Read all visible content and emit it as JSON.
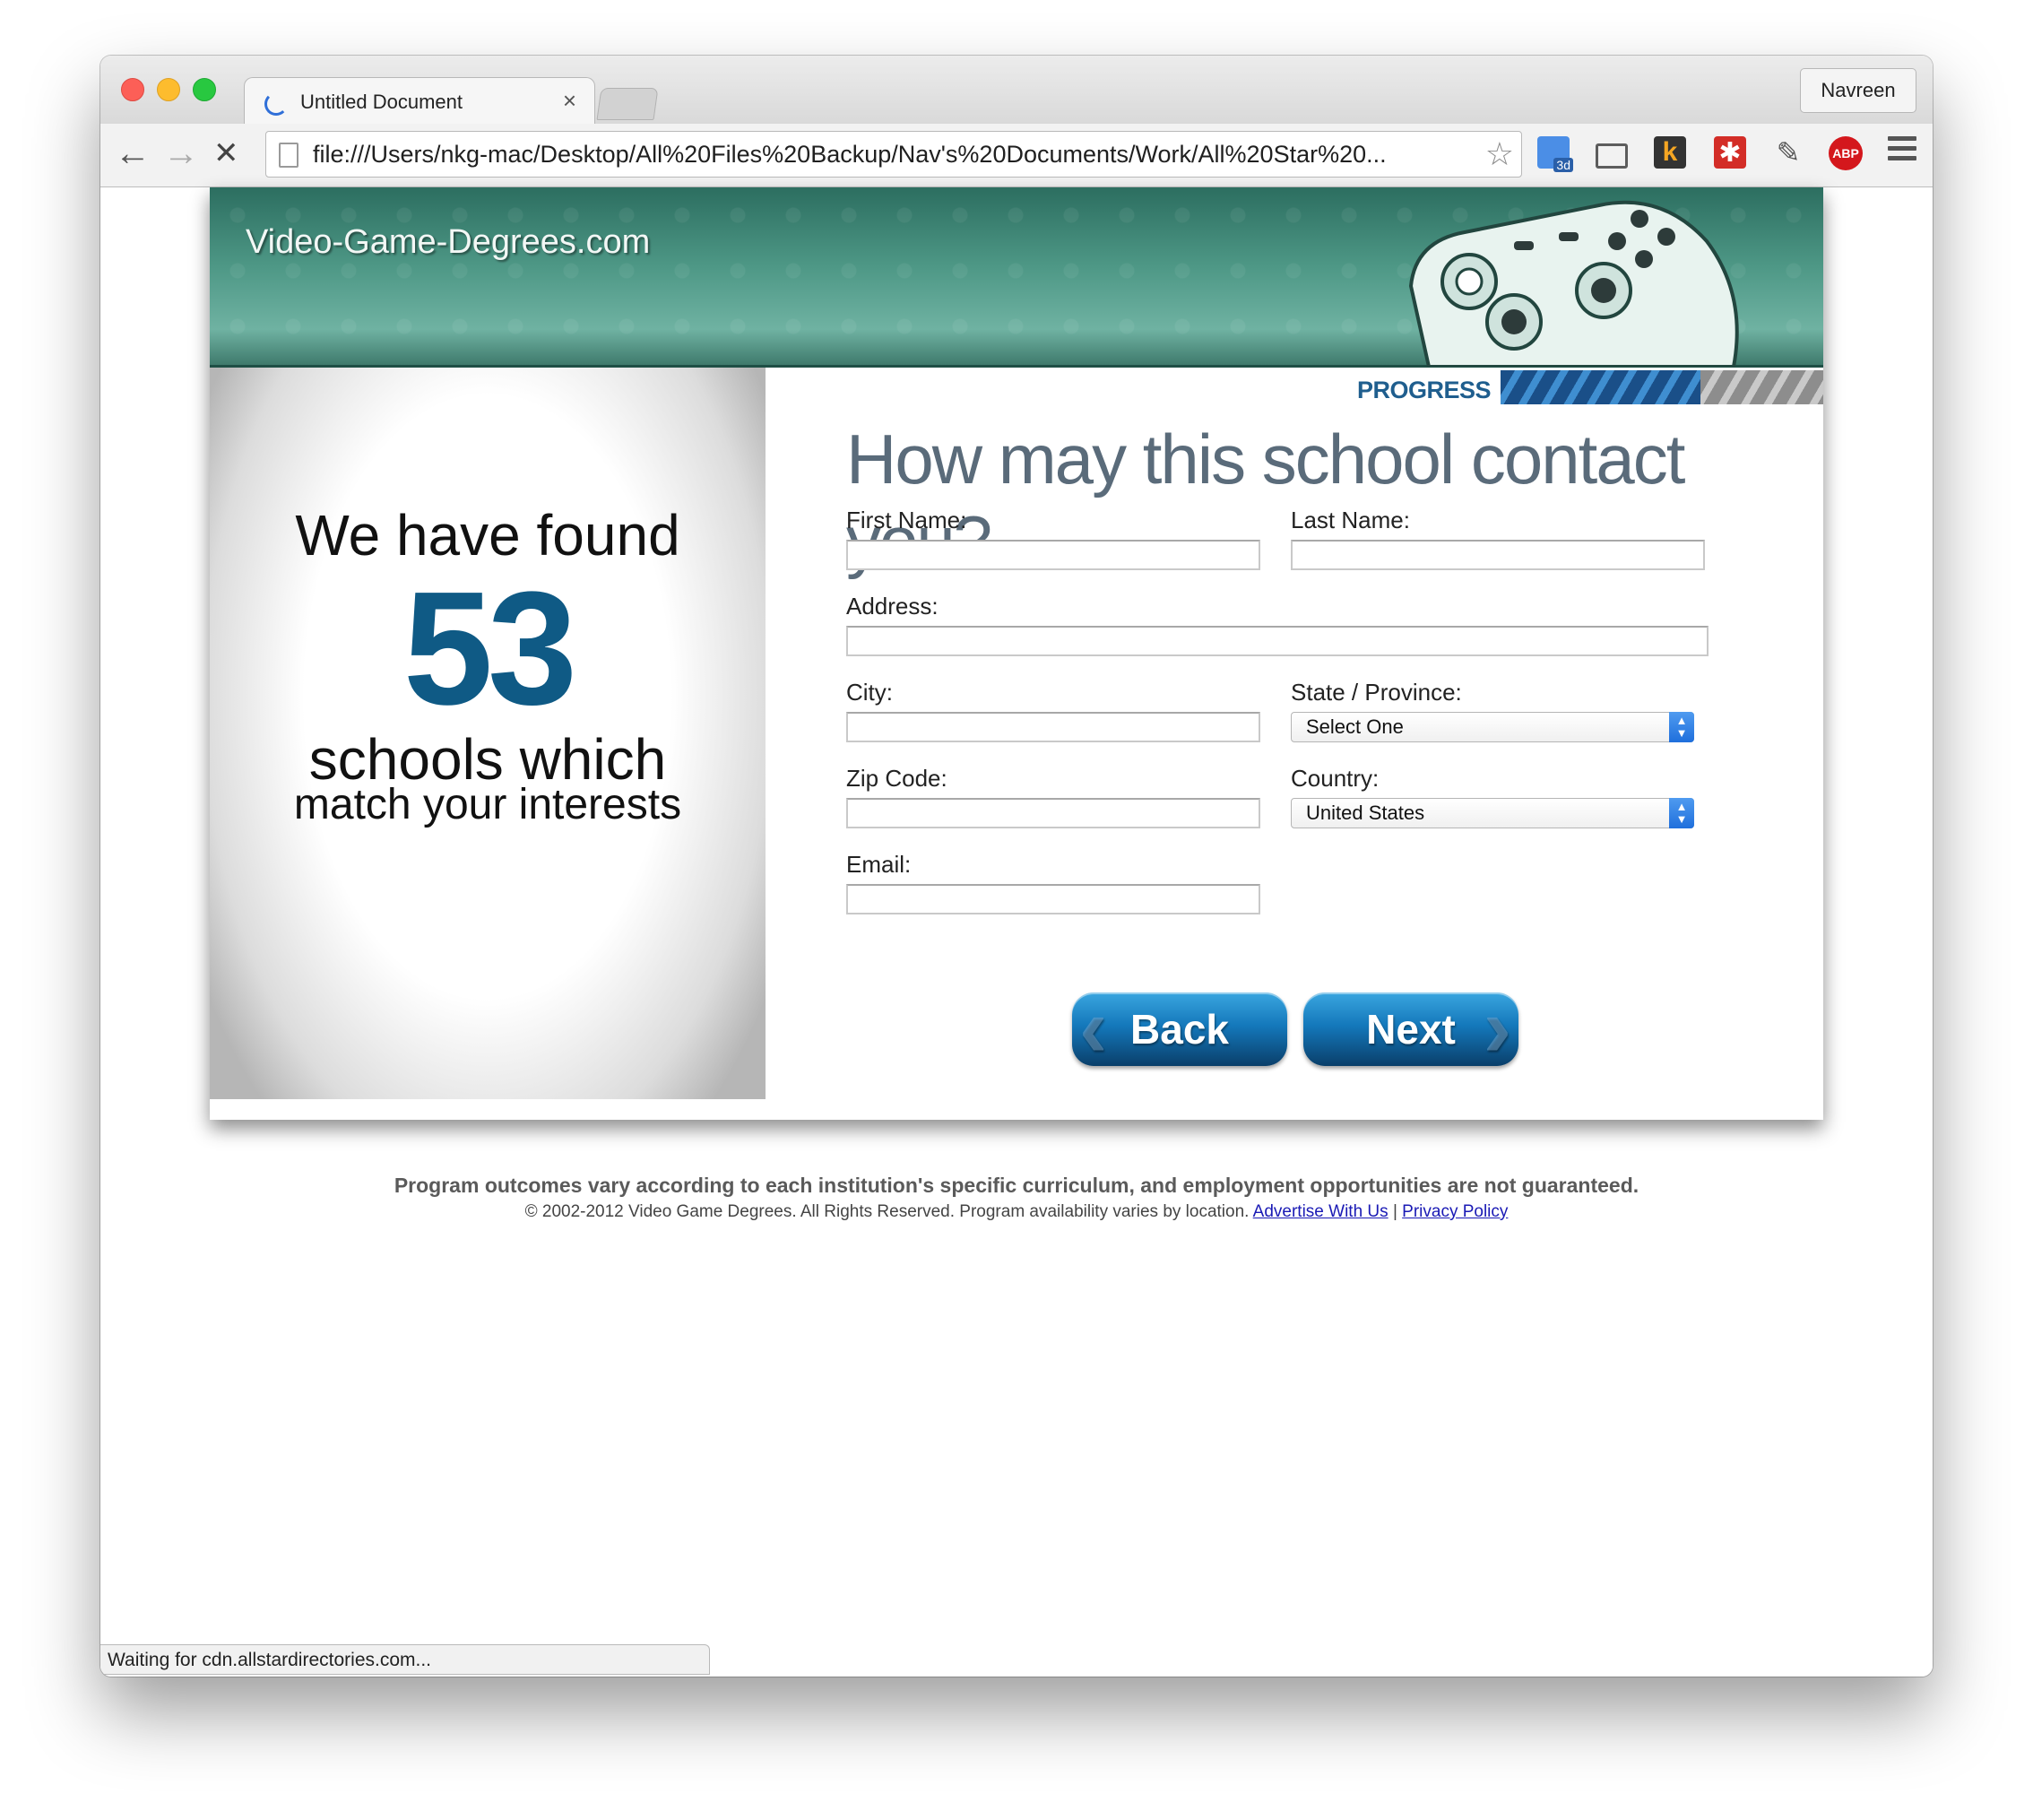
{
  "browser": {
    "tab_title": "Untitled Document",
    "tab_close": "×",
    "profile_name": "Navreen",
    "url": "file:///Users/nkg-mac/Desktop/All%20Files%20Backup/Nav's%20Documents/Work/All%20Star%20...",
    "back_icon": "←",
    "forward_icon": "→",
    "stop_icon": "✕",
    "star_icon": "☆",
    "extensions": [
      {
        "name": "3d-extension-icon",
        "label": "3d"
      },
      {
        "name": "cast-icon",
        "label": ""
      },
      {
        "name": "k-extension-icon",
        "label": "k"
      },
      {
        "name": "lastpass-icon",
        "label": "✱"
      },
      {
        "name": "eyedropper-icon",
        "label": "✎"
      },
      {
        "name": "adblock-plus-icon",
        "label": "ABP"
      }
    ],
    "status_text": "Waiting for cdn.allstardirectories.com..."
  },
  "site": {
    "title": "Video-Game-Degrees.com",
    "progress_label": "PROGRESS",
    "progress_fraction": 0.62
  },
  "results": {
    "line1": "We have found",
    "count": "53",
    "line2": "schools which",
    "line3": "match your interests"
  },
  "form": {
    "heading": "How may this school contact you?",
    "first_name_label": "First Name:",
    "last_name_label": "Last Name:",
    "address_label": "Address:",
    "city_label": "City:",
    "state_label": "State / Province:",
    "state_value": "Select One",
    "zip_label": "Zip Code:",
    "country_label": "Country:",
    "country_value": "United States",
    "email_label": "Email:",
    "back_label": "Back",
    "next_label": "Next"
  },
  "footer": {
    "disclaimer": "Program outcomes vary according to each institution's specific curriculum, and employment opportunities are not guaranteed.",
    "copyright": "© 2002-2012 Video Game Degrees. All Rights Reserved. Program availability varies by location.",
    "advertise_link": "Advertise With Us",
    "separator": "|",
    "privacy_link": "Privacy Policy"
  },
  "colors": {
    "header_green": "#4e9886",
    "accent_blue": "#0f5a85",
    "progress_blue": "#1f5e8e",
    "link_blue": "#1a1ab5"
  }
}
